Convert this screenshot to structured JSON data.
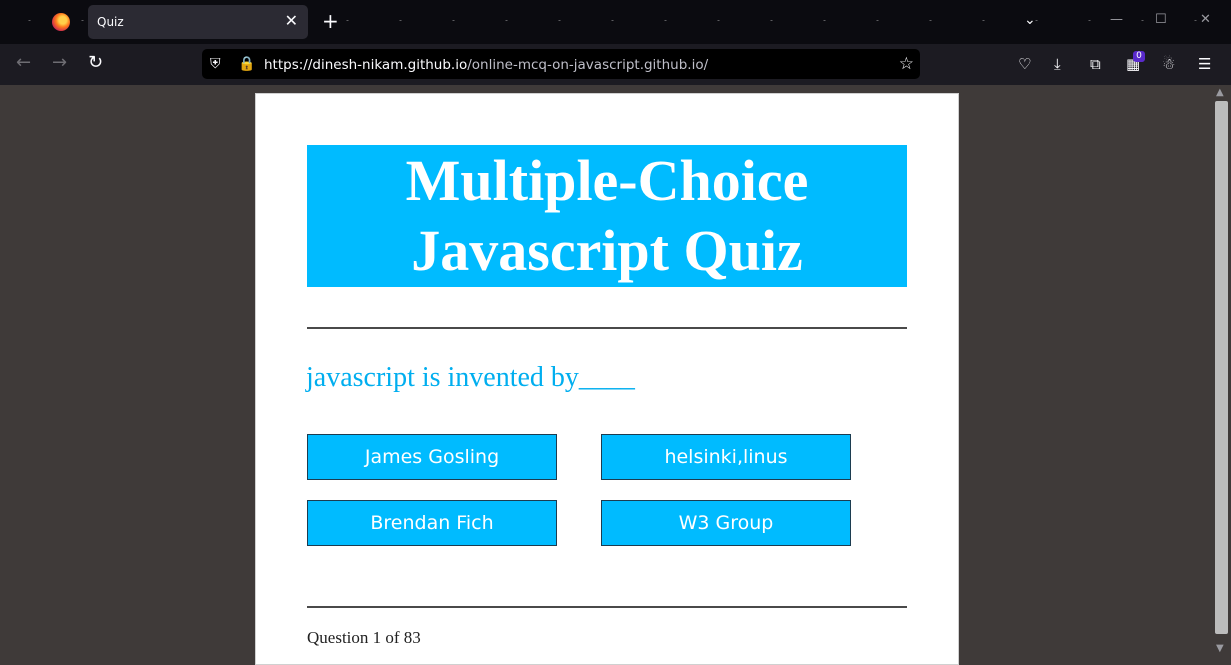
{
  "browser": {
    "tab_title": "Quiz",
    "tab_close": "✕",
    "new_tab": "+",
    "url_host": "https://dinesh-nikam.github.io",
    "url_path": "/online-mcq-on-javascript.github.io/",
    "extension_badge_count": "0"
  },
  "quiz": {
    "title_line1": "Multiple-Choice",
    "title_line2": "Javascript Quiz",
    "question": "javascript is invented by____",
    "choices": [
      "James Gosling",
      "helsinki,linus",
      "Brendan Fich",
      "W3 Group"
    ],
    "progress": "Question 1 of 83"
  },
  "colors": {
    "accent": "#00bbff",
    "question_text": "#00aeef"
  }
}
